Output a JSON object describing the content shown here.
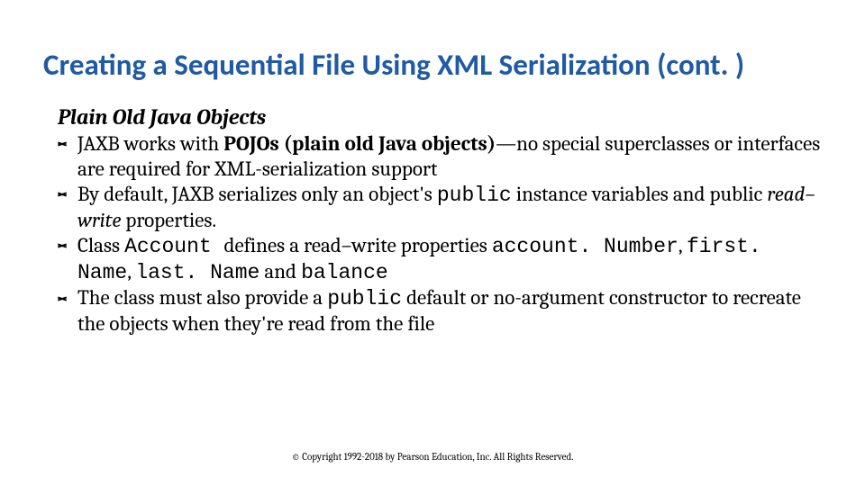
{
  "title": "Creating a Sequential File Using XML Serialization (cont. )",
  "subhead": "Plain Old Java Objects",
  "bullets": [
    {
      "t1": "JAXB works with ",
      "bold1": "POJOs (plain old Java objects)",
      "t2": "—no special superclasses or interfaces are required for XML-serialization support"
    },
    {
      "t1": "By default, JAXB serializes only an object's ",
      "code1": "public",
      "t2": " instance variables and public ",
      "ital1": "read–write",
      "t3": " properties."
    },
    {
      "t1": "Class ",
      "code1": "Account ",
      "t2": " defines a read–write properties ",
      "code2": "account. Number",
      "t3": ", ",
      "code3": "first. Name",
      "t4": ", ",
      "code4": "last. Name",
      "t5": " and ",
      "code5": "balance"
    },
    {
      "t1": "The class must also provide a ",
      "code1": "public",
      "t2": " default or no-argument constructor to recreate the objects when they're read from the file"
    }
  ],
  "footer": "© Copyright 1992-2018 by Pearson Education, Inc. All Rights Reserved."
}
